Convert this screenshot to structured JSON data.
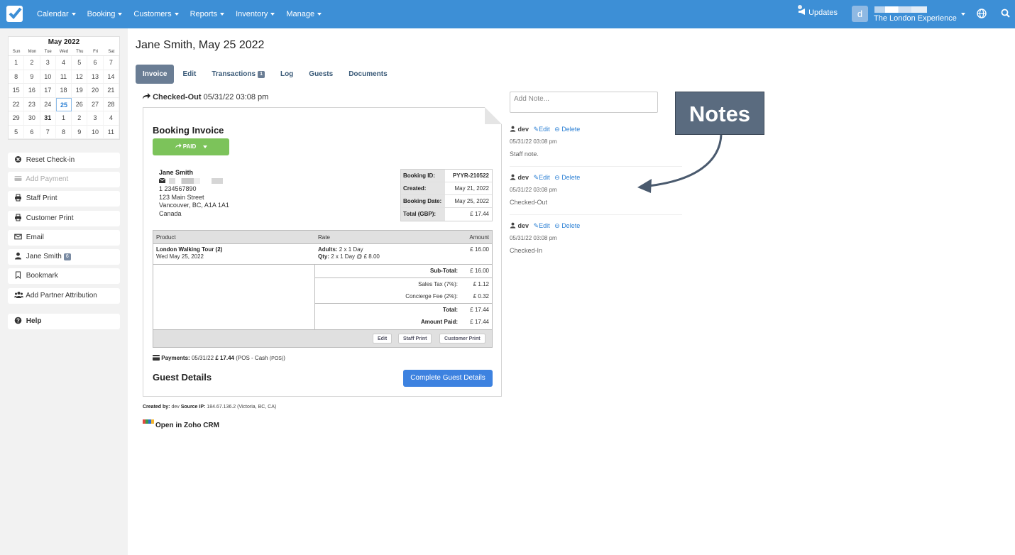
{
  "nav": {
    "items": [
      "Calendar",
      "Booking",
      "Customers",
      "Reports",
      "Inventory",
      "Manage"
    ],
    "updates_label": "Updates",
    "avatar_letter": "d",
    "company": "The London Experience",
    "brand_color": "#3d8fd6"
  },
  "calendar": {
    "title": "May 2022",
    "dow": [
      "Sun",
      "Mon",
      "Tue",
      "Wed",
      "Thu",
      "Fri",
      "Sat"
    ],
    "weeks": [
      [
        "1",
        "2",
        "3",
        "4",
        "5",
        "6",
        "7"
      ],
      [
        "8",
        "9",
        "10",
        "11",
        "12",
        "13",
        "14"
      ],
      [
        "15",
        "16",
        "17",
        "18",
        "19",
        "20",
        "21"
      ],
      [
        "22",
        "23",
        "24",
        "25",
        "26",
        "27",
        "28"
      ],
      [
        "29",
        "30",
        "31",
        "1",
        "2",
        "3",
        "4"
      ],
      [
        "5",
        "6",
        "7",
        "8",
        "9",
        "10",
        "11"
      ]
    ],
    "selected": "25",
    "bold": "31"
  },
  "sidebar": {
    "reset_checkin": "Reset Check-in",
    "add_payment": "Add Payment",
    "staff_print": "Staff Print",
    "customer_print": "Customer Print",
    "email": "Email",
    "customer_name": "Jane Smith",
    "customer_badge": "6",
    "bookmark": "Bookmark",
    "partner": "Add Partner Attribution",
    "help": "Help"
  },
  "page": {
    "title": "Jane Smith, May 25 2022",
    "tabs": {
      "invoice": "Invoice",
      "edit": "Edit",
      "transactions": "Transactions",
      "transactions_badge": "1",
      "log": "Log",
      "guests": "Guests",
      "documents": "Documents"
    },
    "status_label": "Checked-Out",
    "status_time": "05/31/22 03:08 pm"
  },
  "invoice": {
    "title": "Booking Invoice",
    "paid_label": "PAID",
    "customer": {
      "name": "Jane Smith",
      "phone": "1 234567890",
      "address1": "123 Main Street",
      "address2": "Vancouver, BC, A1A 1A1",
      "country": "Canada"
    },
    "booking_info": [
      {
        "k": "Booking ID:",
        "v": "PYYR-210522"
      },
      {
        "k": "Created:",
        "v": "May 21, 2022"
      },
      {
        "k": "Booking Date:",
        "v": "May 25, 2022"
      },
      {
        "k": "Total (GBP):",
        "v": "£ 17.44"
      }
    ],
    "table": {
      "headers": [
        "Product",
        "Rate",
        "Amount"
      ],
      "product": "London Walking Tour (2)",
      "product_date": "Wed May 25, 2022",
      "rate_adults_label": "Adults:",
      "rate_adults": "2 x 1 Day",
      "rate_qty_label": "Qty:",
      "rate_qty": "2 x 1 Day @ £ 8.00",
      "amount": "£ 16.00"
    },
    "totals": [
      {
        "k": "Sub-Total:",
        "v": "£ 16.00"
      },
      {
        "k": "Sales Tax (7%):",
        "v": "£ 1.12"
      },
      {
        "k": "Concierge Fee (2%):",
        "v": "£ 0.32"
      },
      {
        "k": "Total:",
        "v": "£ 17.44"
      },
      {
        "k": "Amount Paid:",
        "v": "£ 17.44"
      }
    ],
    "buttons": {
      "edit": "Edit",
      "staff_print": "Staff Print",
      "customer_print": "Customer Print"
    },
    "payments": {
      "label": "Payments:",
      "date": "05/31/22",
      "amount": "£ 17.44",
      "method": "(POS - Cash",
      "method_note": "(POS)",
      "close": ")"
    },
    "guest_title": "Guest Details",
    "complete_btn": "Complete Guest Details"
  },
  "footer": {
    "created_by_label": "Created by:",
    "created_by": "dev",
    "source_ip_label": "Source IP:",
    "source_ip": "184.67.136.2 (Victoria, BC, CA)",
    "zoho": "Open in Zoho CRM"
  },
  "notes": {
    "placeholder": "Add Note...",
    "edit_label": "Edit",
    "delete_label": "Delete",
    "items": [
      {
        "user": "dev",
        "time": "05/31/22 03:08 pm",
        "text": "Staff note."
      },
      {
        "user": "dev",
        "time": "05/31/22 03:08 pm",
        "text": "Checked-Out"
      },
      {
        "user": "dev",
        "time": "05/31/22 03:08 pm",
        "text": "Checked-In"
      }
    ],
    "callout": "Notes"
  }
}
